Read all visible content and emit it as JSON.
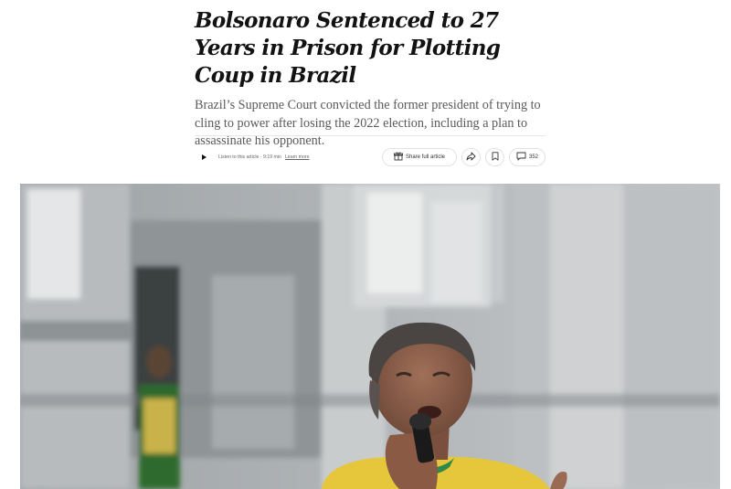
{
  "article": {
    "headline": "Bolsonaro Sentenced to 27 Years in Prison for Plotting Coup in Brazil",
    "summary": "Brazil’s Supreme Court convicted the former president of trying to cling to power after losing the 2022 election, including a plan to assassinate his opponent."
  },
  "toolbar": {
    "listen_label": "Listen to this article · 9:19 min",
    "learn_more": "Learn more",
    "share_label": "Share full article",
    "comment_count": "352",
    "icons": {
      "play": "play-icon",
      "gift": "gift-icon",
      "share": "share-arrow-icon",
      "save": "bookmark-icon",
      "comment": "comment-icon"
    }
  },
  "photo": {
    "subject": "Man in yellow shirt speaking into a microphone in front of a building",
    "colors": {
      "shirt": "#e9c93a",
      "collar": "#2f8a4a",
      "building": "#a9adb0"
    }
  }
}
